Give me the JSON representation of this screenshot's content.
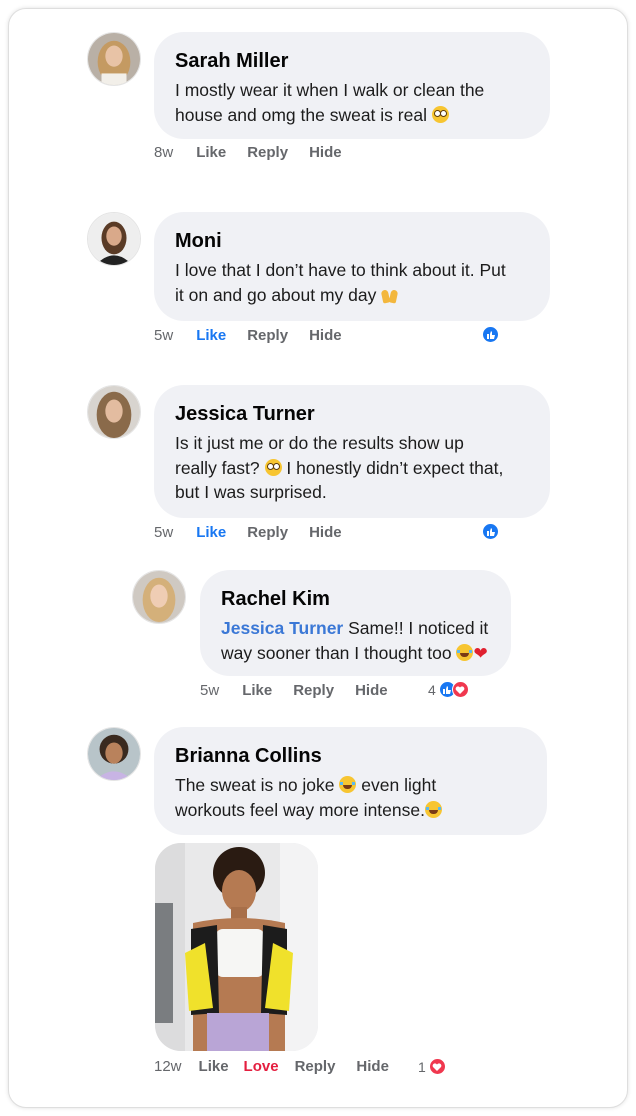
{
  "comments": [
    {
      "name": "Sarah Miller",
      "text_1": "I mostly wear it when I walk or clean the",
      "text_2": "house and omg the sweat is real",
      "emoji": "flushed-face",
      "time": "8w",
      "like": "Like",
      "reply": "Reply",
      "hide": "Hide"
    },
    {
      "name": "Moni",
      "text_1": "I love that I don’t have to think about it. Put",
      "text_2": "it on and go about my day",
      "emoji": "raising-hands",
      "time": "5w",
      "like": "Like",
      "reply": "Reply",
      "hide": "Hide",
      "reactions": [
        "like-reaction"
      ]
    },
    {
      "name": "Jessica Turner",
      "text_1": "Is it just me or do the results show up",
      "text_2a": "really fast?",
      "text_2b": "I honestly didn’t expect that,",
      "text_3": "but I was surprised.",
      "emoji": "flushed-face",
      "time": "5w",
      "like": "Like",
      "reply": "Reply",
      "hide": "Hide",
      "reactions": [
        "like-reaction"
      ]
    },
    {
      "name": "Rachel Kim",
      "mention": "Jessica Turner",
      "text_1": "Same!! I noticed it",
      "text_2": "way sooner than I thought too",
      "emoji": "crying-face",
      "heart": "❤",
      "time": "5w",
      "like": "Like",
      "reply": "Reply",
      "hide": "Hide",
      "reaction_count": "4",
      "reactions": [
        "like-reaction",
        "love-reaction"
      ]
    },
    {
      "name": "Brianna Collins",
      "text_1a": "The sweat is no joke",
      "text_1b": "even light",
      "text_2": "workouts feel way more intense.",
      "emoji": "joy-face",
      "time": "12w",
      "like": "Like",
      "love": "Love",
      "reply": "Reply",
      "hide": "Hide",
      "reaction_count": "1",
      "reactions": [
        "love-reaction"
      ]
    }
  ],
  "colors": {
    "bubble": "#f0f1f5",
    "liked": "#1877f2",
    "loved": "#e41e3f",
    "mention": "#3b78d6",
    "meta": "#65676b"
  }
}
